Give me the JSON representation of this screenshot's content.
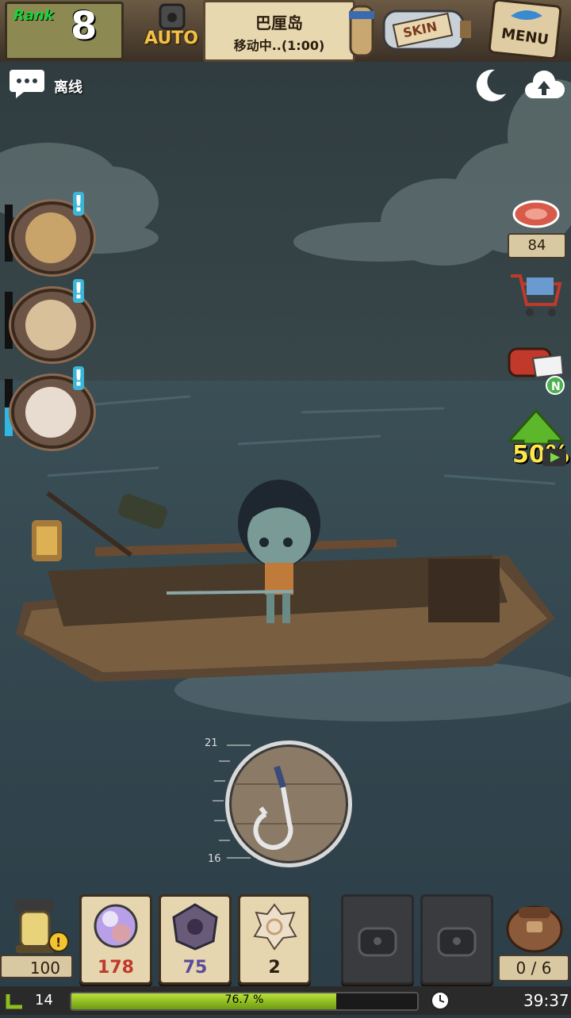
{
  "top_bar": {
    "rank_label": "Rank",
    "rank_value": "8",
    "auto_label": "AUTO",
    "location_name": "巴厘岛",
    "location_status": "移动中..(1:00)",
    "skin_label": "SKIN",
    "menu_label": "MENU"
  },
  "status": {
    "offline_label": "离线"
  },
  "right_panel": {
    "meat_count": "84",
    "boost_label": "50%",
    "mail_badge": "N"
  },
  "fishing": {
    "depth_max": "21",
    "depth_min": "16"
  },
  "bottom": {
    "lantern_count": "100",
    "items": [
      {
        "name": "pearl-orb",
        "count": "178",
        "color": "#c0392b"
      },
      {
        "name": "purple-shell",
        "count": "75",
        "color": "#5a4a9a"
      },
      {
        "name": "spiral-shell",
        "count": "2",
        "color": "#2a1e10"
      }
    ],
    "bag_count": "0 / 6"
  },
  "xp": {
    "level": "14",
    "progress_percent": 76.7,
    "progress_label": "76.7 %",
    "timer": "39:37"
  },
  "colors": {
    "sky": "#2d3a3f",
    "sea": "#34474f",
    "rank_green": "#19d43a",
    "xp_green": "#8cbf20"
  }
}
